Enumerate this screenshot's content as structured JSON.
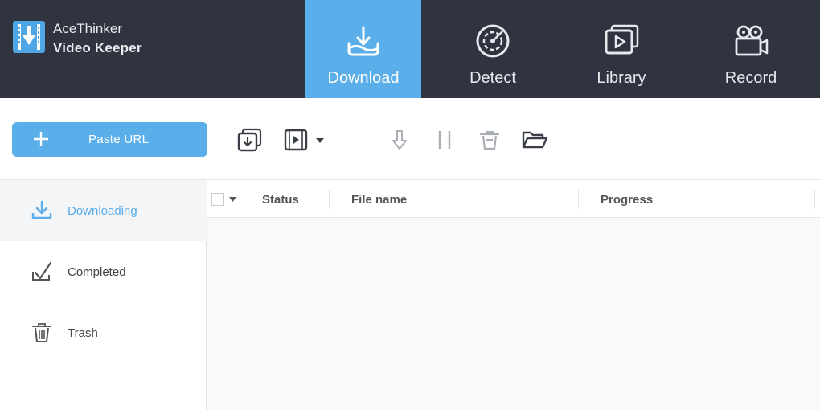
{
  "app": {
    "brand_line1": "AceThinker",
    "brand_line2": "Video Keeper"
  },
  "nav": {
    "tabs": [
      {
        "label": "Download",
        "icon": "download-tray-icon",
        "active": true
      },
      {
        "label": "Detect",
        "icon": "radar-icon",
        "active": false
      },
      {
        "label": "Library",
        "icon": "video-library-icon",
        "active": false
      },
      {
        "label": "Record",
        "icon": "video-camera-icon",
        "active": false
      }
    ]
  },
  "toolbar": {
    "paste_label": "Paste URL",
    "icons": [
      "import-download-icon",
      "video-file-icon",
      "resume-download-icon",
      "pause-icon",
      "delete-icon",
      "open-folder-icon"
    ]
  },
  "sidebar": {
    "items": [
      {
        "label": "Downloading",
        "icon": "download-icon",
        "active": true
      },
      {
        "label": "Completed",
        "icon": "check-icon",
        "active": false
      },
      {
        "label": "Trash",
        "icon": "trash-icon",
        "active": false
      }
    ]
  },
  "table": {
    "columns": [
      "Status",
      "File name",
      "Progress"
    ],
    "rows": []
  },
  "colors": {
    "header_bg": "#2f3440",
    "accent": "#5aaee9",
    "content_bg": "#f8f9fa"
  }
}
